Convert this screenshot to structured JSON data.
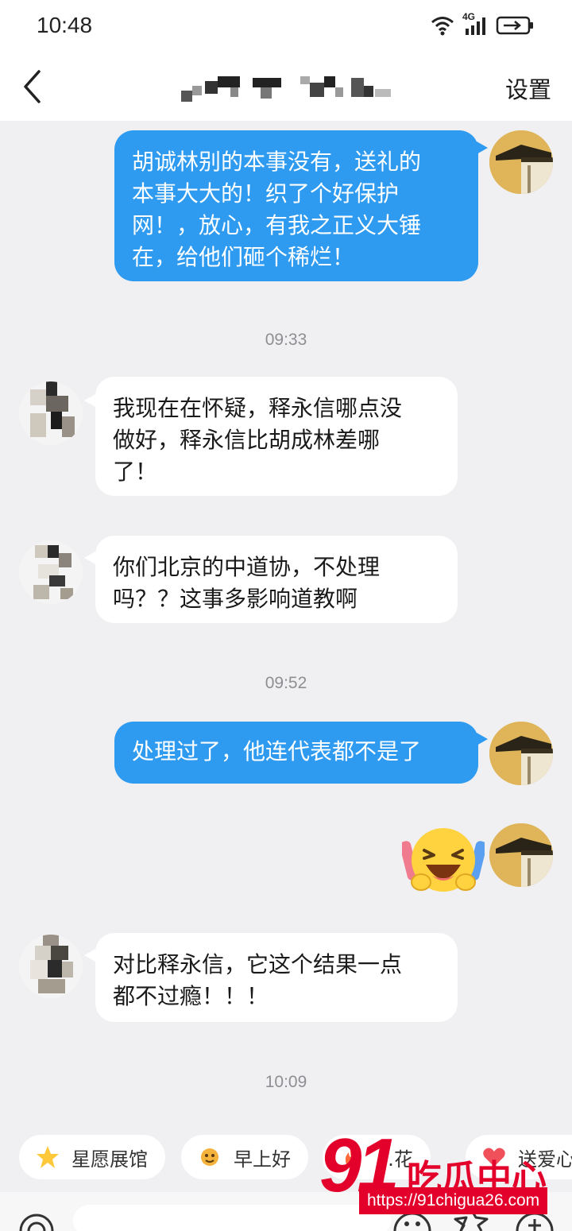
{
  "status_bar": {
    "time": "10:48",
    "network": "4G"
  },
  "header": {
    "title": "",
    "settings_label": "设置"
  },
  "messages": [
    {
      "side": "self",
      "text_lines": [
        "胡诚林别的本事没有，送礼的",
        "本事大大的！织了个好保护",
        "网！，放心，有我之正义大锤",
        "在，给他们砸个稀烂！"
      ]
    },
    {
      "type": "time",
      "text": "09:33"
    },
    {
      "side": "other",
      "text_lines": [
        "我现在在怀疑，释永信哪点没",
        "做好，释永信比胡成林差哪",
        "了！"
      ]
    },
    {
      "side": "other",
      "text_lines": [
        "你们北京的中道协，不处理",
        "吗？？这事多影响道教啊"
      ]
    },
    {
      "type": "time",
      "text": "09:52"
    },
    {
      "side": "self",
      "text_lines": [
        "处理过了，他连代表都不是了"
      ]
    },
    {
      "side": "self",
      "sticker": "laughing-emoji-sticker"
    },
    {
      "side": "other",
      "text_lines": [
        "对比释永信，它这个结果一点",
        "都不过瘾！！！"
      ]
    },
    {
      "type": "time",
      "text": "10:09"
    }
  ],
  "quick_actions": [
    {
      "label": "星愿展馆",
      "icon": "star-icon"
    },
    {
      "label": "早上好",
      "icon": "sun-face-icon"
    },
    {
      "label": "…花",
      "icon": "fire-icon"
    },
    {
      "label": "送爱心",
      "icon": "heart-icon"
    }
  ],
  "watermark": {
    "number": "91",
    "name": "吃瓜中心",
    "url": "https://91chigua26.com"
  },
  "colors": {
    "self_bubble": "#2e9bf0",
    "other_bubble": "#ffffff",
    "background": "#f0f0f2",
    "watermark": "#e3002b"
  }
}
